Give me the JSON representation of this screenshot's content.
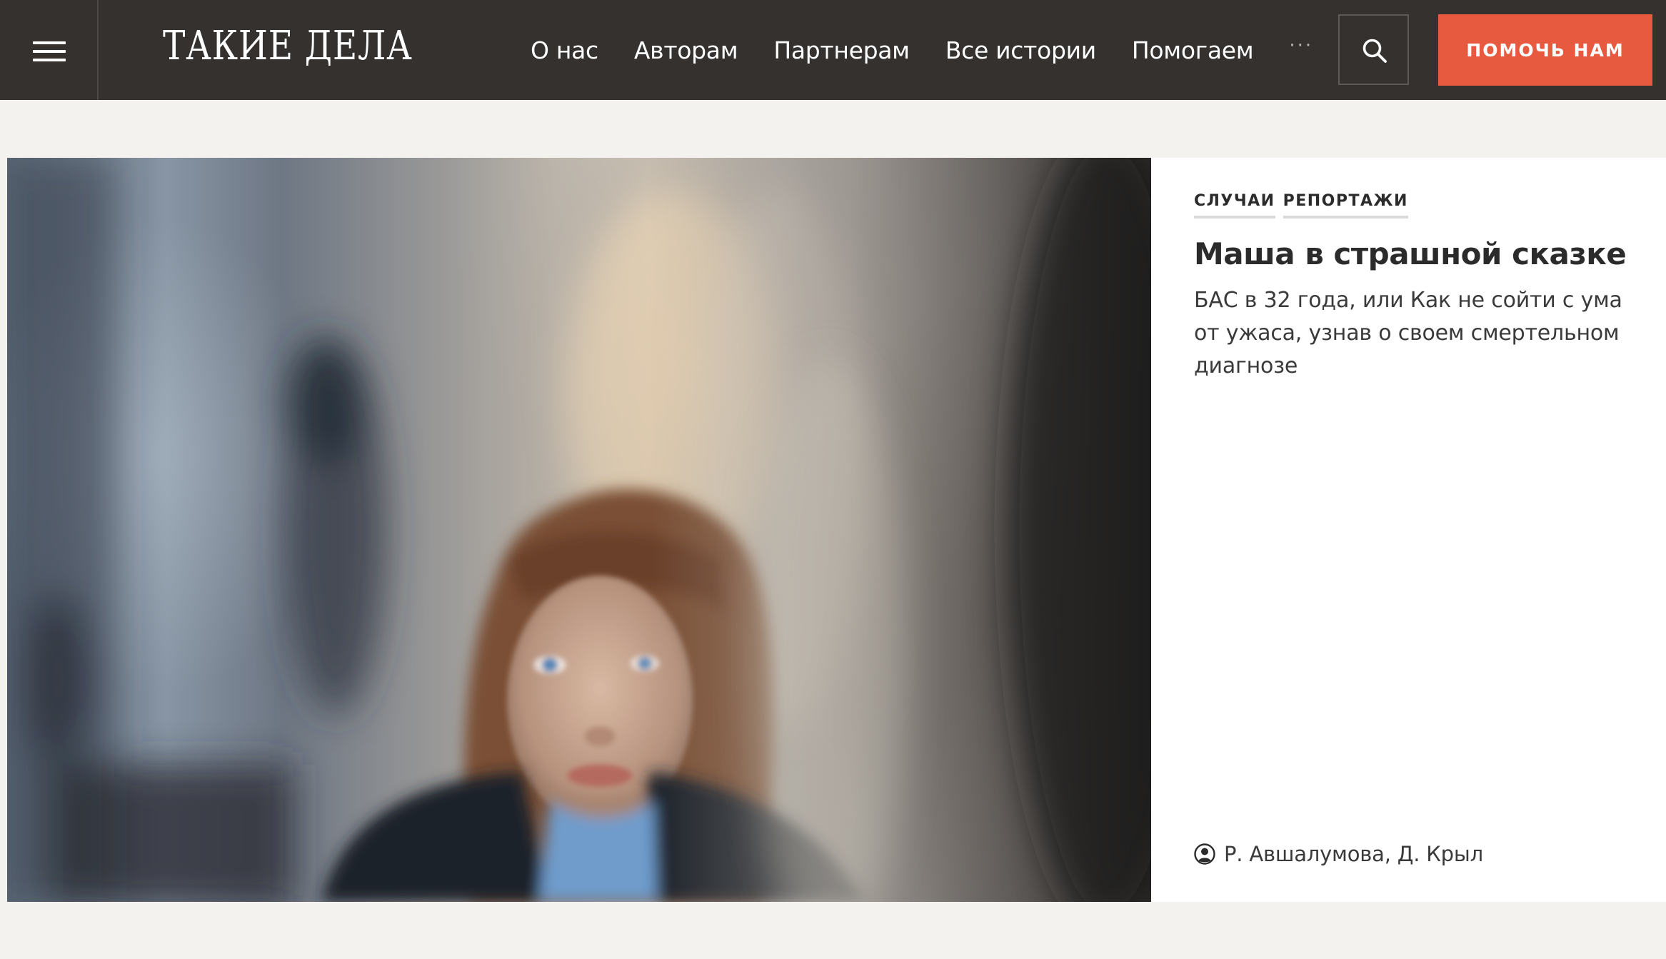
{
  "header": {
    "logo": "ТАКИЕ ДЕЛА",
    "menu_icon": "hamburger-menu-icon",
    "nav": [
      {
        "label": "О нас"
      },
      {
        "label": "Авторам"
      },
      {
        "label": "Партнерам"
      },
      {
        "label": "Все истории"
      },
      {
        "label": "Помогаем"
      }
    ],
    "more_label": "···",
    "search_icon": "search-icon",
    "help_button": "ПОМОЧЬ НАМ",
    "colors": {
      "background": "#34312e",
      "accent": "#e85a3f"
    }
  },
  "feature": {
    "tags": [
      "СЛУЧАИ",
      "РЕПОРТАЖИ"
    ],
    "headline": "Маша в страшной сказке",
    "lead": "БАС в 32 года, или Как не сойти с ума от ужаса, узнав о своем смертельном диагнозе",
    "authors": "Р. Авшалумова, Д. Крыл",
    "author_icon": "user-circle-icon"
  }
}
